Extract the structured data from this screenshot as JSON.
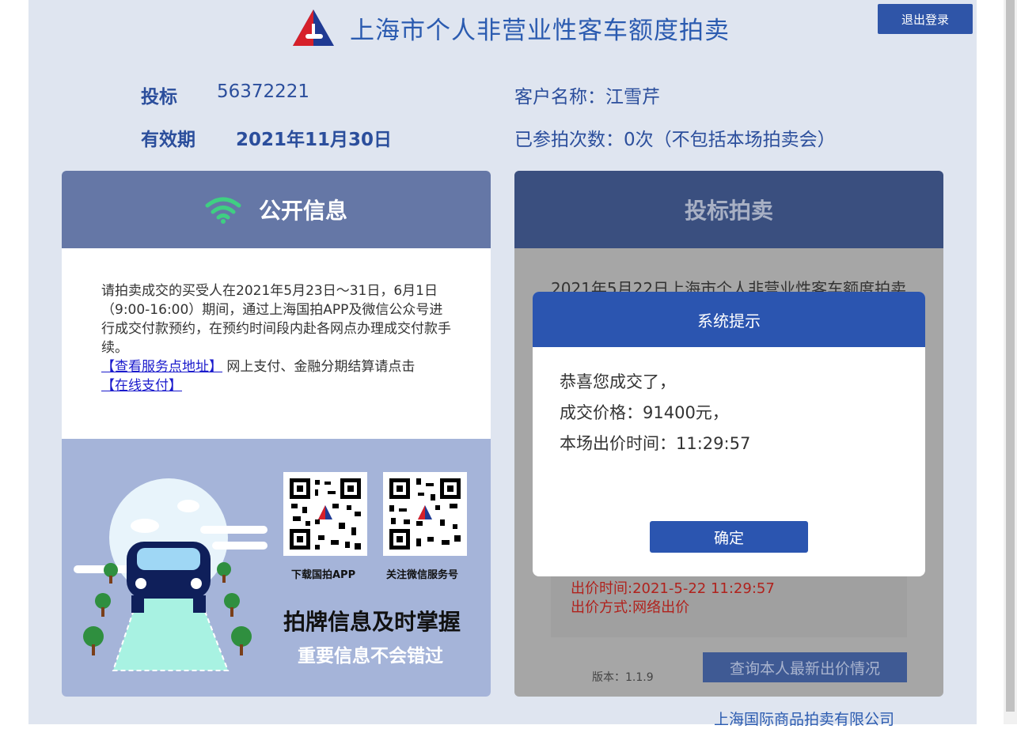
{
  "header": {
    "title": "上海市个人非营业性客车额度拍卖",
    "logout_label": "退出登录"
  },
  "bidder": {
    "bid_label": "投标",
    "bid_number": "56372221",
    "validity_label": "有效期",
    "validity_date": "2021年11月30日",
    "customer_name": "客户名称：江雪芹",
    "participation": "已参拍次数：0次（不包括本场拍卖会）"
  },
  "public_info": {
    "title": "公开信息",
    "notice_text": "请拍卖成交的买受人在2021年5月23日～31日，6月1日（9:00-16:00）期间，通过上海国拍APP及微信公众号进行成交付款预约，在预约时间段内赴各网点办理成交付款手续。",
    "service_link": "【查看服务点地址】",
    "online_pay_text": " 网上支付、金融分期结算请点击",
    "pay_link": "【在线支付】",
    "qr_app_label": "下载国拍APP",
    "qr_wechat_label": "关注微信服务号",
    "promo_main": "拍牌信息及时掌握",
    "promo_sub": "重要信息不会错过"
  },
  "auction": {
    "title": "投标拍卖",
    "session_title": "2021年5月22日上海市个人非营业性客车额度拍卖",
    "bid_time": "出价时间:2021-5-22 11:29:57",
    "bid_method": "出价方式:网络出价",
    "version": "版本：1.1.9",
    "query_button": "查询本人最新出价情况"
  },
  "modal": {
    "title": "系统提示",
    "line1": "恭喜您成交了，",
    "line2": "成交价格：91400元，",
    "line3": "本场出价时间：11:29:57",
    "ok_label": "确定"
  },
  "footer": {
    "company": "上海国际商品拍卖有限公司"
  },
  "colors": {
    "brand_blue": "#2b55b0",
    "panel_header": "#6577a6",
    "bid_red": "#b0221d"
  }
}
